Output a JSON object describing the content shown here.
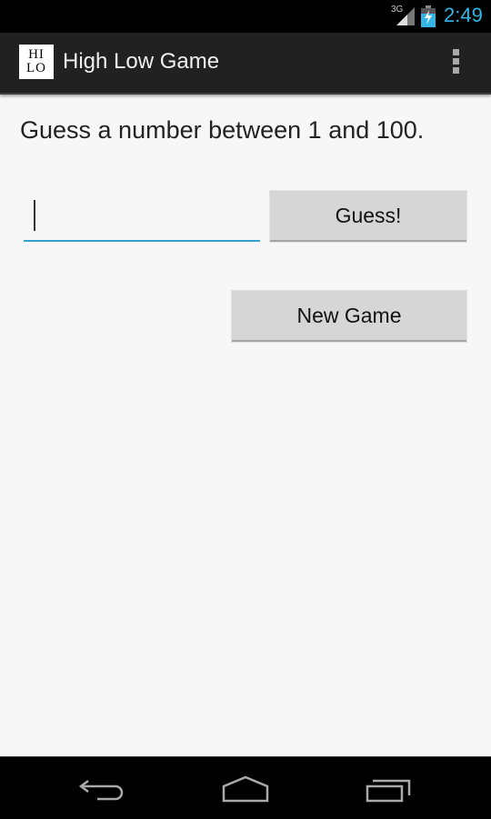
{
  "status_bar": {
    "network": "3G",
    "time": "2:49",
    "accent_color": "#33b5e5"
  },
  "action_bar": {
    "app_icon_line1": "HI",
    "app_icon_line2": "LO",
    "title": "High Low Game",
    "overflow_icon": "overflow-menu-icon"
  },
  "main": {
    "prompt": "Guess a number between 1 and 100.",
    "guess_input": {
      "value": "",
      "placeholder": ""
    },
    "guess_button": "Guess!",
    "new_game_button": "New Game",
    "input_accent_color": "#33a0cc"
  },
  "nav_bar": {
    "back": "back-icon",
    "home": "home-icon",
    "recents": "recents-icon"
  }
}
